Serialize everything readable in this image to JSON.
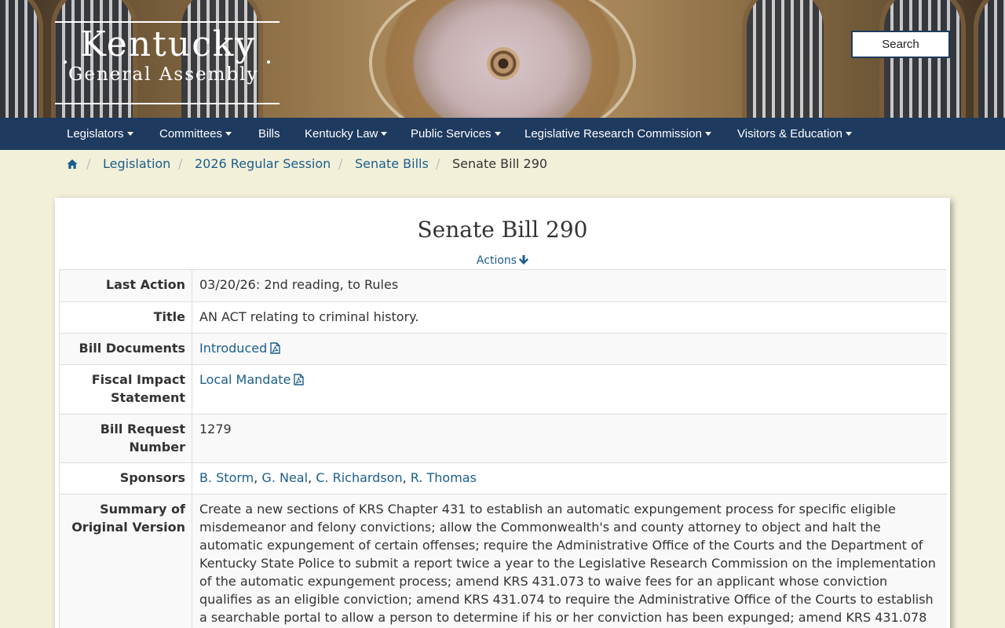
{
  "header": {
    "logo_top": "Kentucky",
    "logo_bottom": "General Assembly",
    "search_label": "Search"
  },
  "nav": [
    {
      "label": "Legislators",
      "dropdown": true
    },
    {
      "label": "Committees",
      "dropdown": true
    },
    {
      "label": "Bills",
      "dropdown": false
    },
    {
      "label": "Kentucky Law",
      "dropdown": true
    },
    {
      "label": "Public Services",
      "dropdown": true
    },
    {
      "label": "Legislative Research Commission",
      "dropdown": true
    },
    {
      "label": "Visitors & Education",
      "dropdown": true
    }
  ],
  "breadcrumb": {
    "home_icon": "home-icon",
    "items": [
      "Legislation",
      "2026 Regular Session",
      "Senate Bills"
    ],
    "current": "Senate Bill 290"
  },
  "bill": {
    "title": "Senate Bill 290",
    "actions_label": "Actions",
    "rows": {
      "last_action": {
        "label": "Last Action",
        "value": "03/20/26: 2nd reading, to Rules"
      },
      "title": {
        "label": "Title",
        "value": "AN ACT relating to criminal history."
      },
      "bill_documents": {
        "label": "Bill Documents",
        "link": "Introduced"
      },
      "fiscal_impact": {
        "label_line1": "Fiscal Impact",
        "label_line2": "Statement",
        "link": "Local Mandate"
      },
      "bill_request": {
        "label_line1": "Bill Request",
        "label_line2": "Number",
        "value": "1279"
      },
      "sponsors": {
        "label": "Sponsors",
        "names": [
          "B. Storm",
          "G. Neal",
          "C. Richardson",
          "R. Thomas"
        ]
      },
      "summary": {
        "label_line1": "Summary of",
        "label_line2": "Original Version",
        "lines": [
          "Create a new sections of KRS Chapter 431 to establish an automatic expungement process for specific eligible",
          "misdemeanor and felony convictions; allow the Commonwealth's and county attorney to object and halt the",
          "automatic expungement of certain offenses; require the Administrative Office of the Courts and the Department of",
          "Kentucky State Police to submit a report twice a year to the Legislative Research Commission on the implementation",
          "of the automatic expungement process; amend KRS 431.073 to waive fees for an applicant whose conviction",
          "qualifies as an eligible conviction; amend KRS 431.074 to require the Administrative Office of the Courts to establish",
          "a searchable portal to allow a person to determine if his or her conviction has been expunged; amend KRS 431.078"
        ]
      }
    }
  },
  "colors": {
    "nav_bg": "#1e3a5f",
    "page_bg": "#f3f0da",
    "link": "#1a5e8c"
  }
}
